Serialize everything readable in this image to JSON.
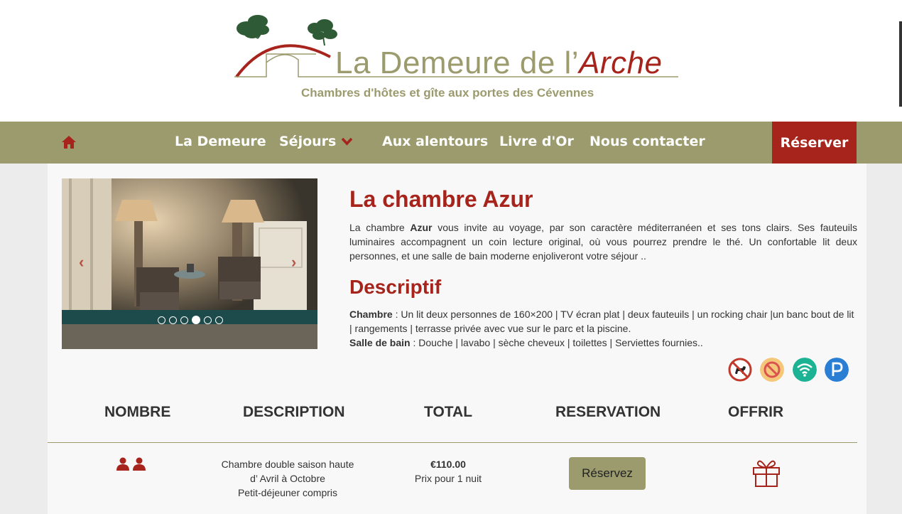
{
  "header": {
    "logo_title_main": "La Demeure de l’",
    "logo_title_accent": "Arche",
    "tagline": "Chambres d'hôtes et gîte aux portes des Cévennes"
  },
  "nav": {
    "home_icon": "home-icon",
    "items": [
      {
        "label": "La Demeure"
      },
      {
        "label": "Séjours"
      },
      {
        "label": "Aux alentours"
      },
      {
        "label": "Livre d'Or"
      },
      {
        "label": "Nous contacter"
      }
    ],
    "reserve_label": "Réserver"
  },
  "carousel": {
    "slide_count": 6,
    "active_slide": 5
  },
  "room": {
    "title": "La chambre Azur",
    "desc_before": "La chambre ",
    "desc_bold": "Azur",
    "desc_after": " vous invite au voyage, par son caractère méditerranéen et ses tons clairs. Ses fauteuils luminaires accompagnent un coin lecture original, où vous pourrez prendre le thé. Un confortable lit deux personnes, et une salle de bain moderne enjoliveront votre séjour .."
  },
  "descriptif": {
    "title": "Descriptif",
    "chambre_label": "Chambre",
    "chambre_text": " : Un lit deux personnes de 160×200 | TV écran plat | deux fauteuils | un rocking chair |un banc bout de lit | rangements | terrasse privée avec vue sur le parc et la piscine.",
    "sdb_label": "Salle de bain",
    "sdb_text": " : Douche | lavabo | sèche cheveux | toilettes | Serviettes fournies.."
  },
  "amenities": [
    {
      "icon": "no-pets-icon"
    },
    {
      "icon": "no-smoking-icon"
    },
    {
      "icon": "wifi-icon"
    },
    {
      "icon": "parking-icon"
    }
  ],
  "table": {
    "headers": [
      "NOMBRE",
      "DESCRIPTION",
      "TOTAL",
      "RESERVATION",
      "OFFRIR"
    ],
    "row": {
      "persons_icon": "two-persons-icon",
      "desc_line1": "Chambre double saison haute",
      "desc_line2": "d’ Avril à Octobre",
      "desc_line3": "Petit-déjeuner compris",
      "price": "€110.00",
      "price_note": "Prix pour 1 nuit",
      "reserve_label": "Réservez",
      "gift_icon": "gift-icon"
    }
  },
  "colors": {
    "olive": "#9b9b6e",
    "brand_red": "#a6241b"
  }
}
